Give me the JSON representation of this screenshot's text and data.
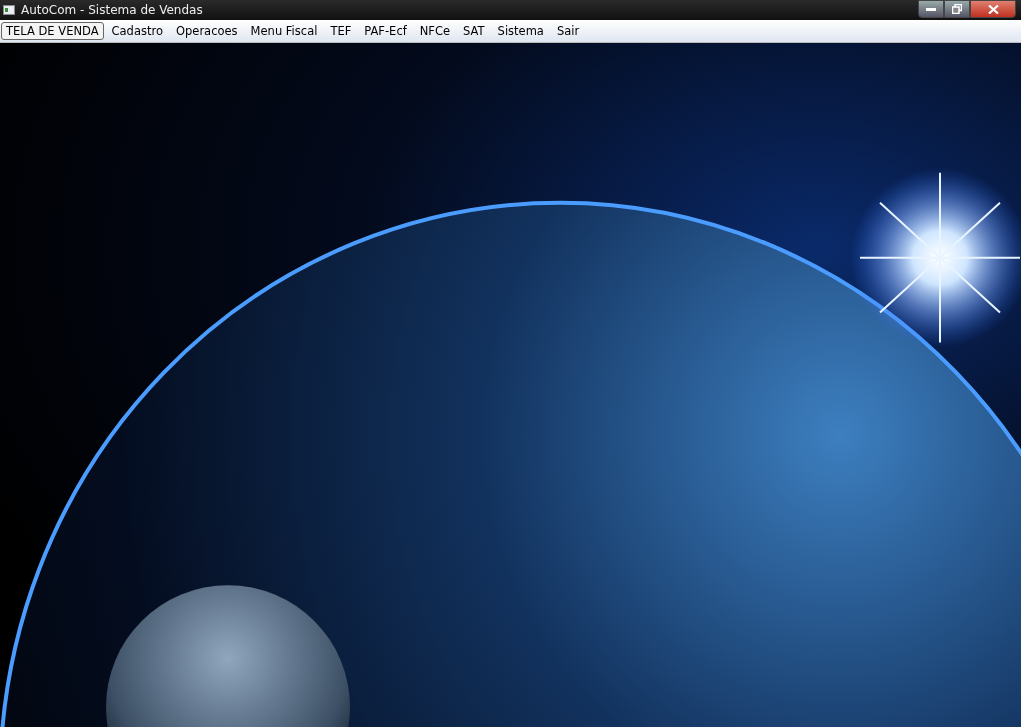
{
  "window": {
    "title": "AutoCom - Sistema de Vendas"
  },
  "menu": [
    {
      "label": "TELA DE VENDA",
      "selected": true
    },
    {
      "label": "Cadastro",
      "selected": false
    },
    {
      "label": "Operacoes",
      "selected": false
    },
    {
      "label": "Menu Fiscal",
      "selected": false
    },
    {
      "label": "TEF",
      "selected": false
    },
    {
      "label": "PAF-Ecf",
      "selected": false
    },
    {
      "label": "NFCe",
      "selected": false
    },
    {
      "label": "SAT",
      "selected": false
    },
    {
      "label": "Sistema",
      "selected": false
    },
    {
      "label": "Sair",
      "selected": false
    }
  ]
}
